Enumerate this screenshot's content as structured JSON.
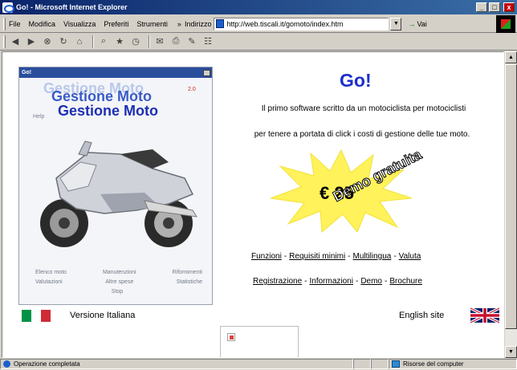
{
  "window": {
    "title": "Go! - Microsoft Internet Explorer",
    "min_label": "_",
    "max_label": "□",
    "close_label": "x"
  },
  "menubar": {
    "items": [
      "File",
      "Modifica",
      "Visualizza",
      "Preferiti",
      "Strumenti"
    ],
    "more": "»",
    "address_label": "Indirizzo",
    "address_value": "http://web.tiscali.it/gomoto/index.htm",
    "go_label": "Vai"
  },
  "toolbar": {
    "buttons": [
      "back-icon",
      "forward-icon",
      "stop-icon",
      "refresh-icon",
      "home-icon",
      "search-icon",
      "favorites-icon",
      "history-icon",
      "mail-icon",
      "print-icon",
      "edit-icon",
      "discuss-icon"
    ]
  },
  "app_screenshot": {
    "window_title": "Go!",
    "logo_lines": [
      "Gestione Moto",
      "Gestione Moto",
      "Gestione Moto"
    ],
    "version": "2.0",
    "help": "Help",
    "menu_row1": [
      "Elenco moto",
      "Manutenzioni",
      "Rifornimenti"
    ],
    "menu_row2": [
      "Valutazioni",
      "Altre spese",
      "Statistiche"
    ],
    "menu_stop": "Stop"
  },
  "page": {
    "title": "Go!",
    "description_line1": "Il primo software scritto da un motociclista per motociclisti",
    "description_line2": "per tenere a portata di click i costi di gestione delle tue moto.",
    "price": "€ 25",
    "demo_badge": "Demo gratuita",
    "links_row1": [
      "Funzioni",
      "Requisiti minimi",
      "Multilingua",
      "Valuta"
    ],
    "links_row2": [
      "Registrazione",
      "Informazioni",
      "Demo",
      "Brochure"
    ],
    "link_separator": "-",
    "lang_it": "Versione Italiana",
    "lang_en": "English site"
  },
  "statusbar": {
    "status_text": "Operazione completata",
    "zone_text": "Risorse del computer"
  },
  "colors": {
    "title_blue": "#1d2fcc",
    "flag_green": "#009246",
    "flag_red": "#ce2b37",
    "star_yellow": "#fff25a"
  }
}
